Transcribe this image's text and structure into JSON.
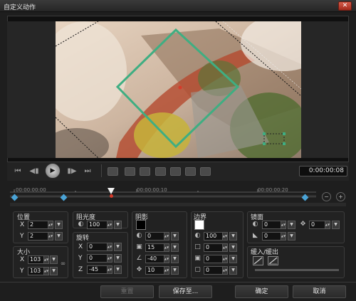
{
  "window": {
    "title": "自定义动作",
    "close_icon": "close-icon"
  },
  "toolbar": {
    "buttons": [
      "skip-start-icon",
      "step-back-icon",
      "play-icon",
      "step-forward-icon",
      "skip-end-icon"
    ],
    "keyframe_tools": [
      "add-keyframe-icon",
      "remove-keyframe-icon",
      "reverse-keyframe-icon",
      "swap-keyframe-icon",
      "prev-keyframe-icon",
      "next-keyframe-icon",
      "copy-keyframe-icon"
    ],
    "timecode": "0:00:00:08"
  },
  "timeline": {
    "ticks": [
      "00:00:00:00",
      "00:00:00:10",
      "00:00:00:20"
    ],
    "zoom_out_icon": "zoom-out-icon",
    "zoom_in_icon": "zoom-in-icon"
  },
  "position": {
    "label": "位置",
    "x_label": "X",
    "x": "2",
    "y_label": "Y",
    "y": "2"
  },
  "size": {
    "label": "大小",
    "x_label": "X",
    "x": "103",
    "y_label": "Y",
    "y": "103",
    "link_icon": "link-icon"
  },
  "opacity": {
    "label": "阻光度",
    "value": "100"
  },
  "rotation": {
    "label": "旋转",
    "x_label": "X",
    "x": "0",
    "y_label": "Y",
    "y": "0",
    "z_label": "Z",
    "z": "-45"
  },
  "shadow": {
    "label": "阴影",
    "color": "#000000",
    "opacity": "0",
    "blur": "15",
    "angle": "-40",
    "distance": "10"
  },
  "border": {
    "label": "边界",
    "color": "#ffffff",
    "opacity": "100",
    "width": "0",
    "v2": "0",
    "v3": "0"
  },
  "mirror": {
    "label": "镜面",
    "v1": "0",
    "v2": "0",
    "v3": "0"
  },
  "fade": {
    "label": "缓入/缓出"
  },
  "footer": {
    "reset": "重置",
    "save_as": "保存至...",
    "ok": "确定",
    "cancel": "取消"
  },
  "colors": {
    "keyframe_line": "#3fae82",
    "keyframe_blue": "#4aa3d6",
    "playhead_red": "#d63a2a"
  }
}
